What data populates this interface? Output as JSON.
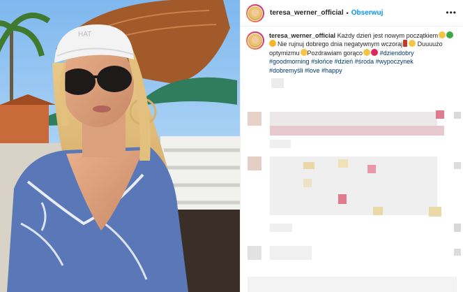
{
  "post": {
    "username": "teresa_werner_official",
    "separator": "•",
    "follow_label": "Obserwuj",
    "more_icon": "more-options-icon"
  },
  "caption": {
    "username": "teresa_werner_official",
    "text1": " Każdy dzień jest nowym początkiem",
    "text2": "Nie rujnuj dobrego dnia negatywnym wczoraj",
    "text3": " Duuuużo optymizmu",
    "text4": "Pozdrawiam gorąco",
    "hashtags": [
      "#dziendobry",
      "#goodmorning",
      "#słońce",
      "#dzień",
      "#środa",
      "#wypoczynek",
      "#dobremyśli",
      "#love",
      "#happy"
    ]
  },
  "colors": {
    "follow": "#0095f6",
    "hashtag": "#00376b",
    "text": "#262626"
  }
}
